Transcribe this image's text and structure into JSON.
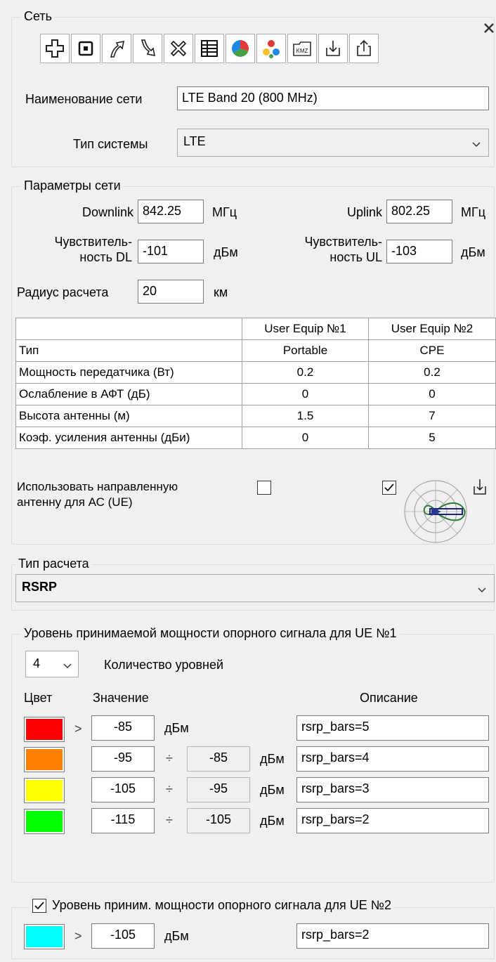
{
  "network_group": {
    "title": "Сеть",
    "toolbar": [
      {
        "icon": "plus-icon"
      },
      {
        "icon": "stop-square-icon"
      },
      {
        "icon": "arrow-up-right-icon"
      },
      {
        "icon": "arrow-down-right-icon"
      },
      {
        "icon": "delete-x-icon"
      },
      {
        "icon": "table-grid-icon"
      },
      {
        "icon": "pie-chart-icon",
        "colors": [
          "#e53935",
          "#43a047",
          "#1e88e5"
        ]
      },
      {
        "icon": "color-dots-icon",
        "colors": [
          "#e53935",
          "#fbc02d",
          "#1e88e5",
          "#43a047"
        ]
      },
      {
        "icon": "kmz-file-icon",
        "label": "KMZ"
      },
      {
        "icon": "download-icon"
      },
      {
        "icon": "share-upload-icon"
      }
    ],
    "close_icon": "close-icon",
    "name_label": "Наименование сети",
    "name_value": "LTE Band 20 (800 MHz)",
    "system_type_label": "Тип системы",
    "system_type_value": "LTE"
  },
  "params": {
    "title": "Параметры сети",
    "downlink_label": "Downlink",
    "downlink_value": "842.25",
    "downlink_unit": "МГц",
    "uplink_label": "Uplink",
    "uplink_value": "802.25",
    "uplink_unit": "МГц",
    "sens_dl_label_1": "Чувствитель-",
    "sens_dl_label_2": "ность DL",
    "sens_dl_value": "-101",
    "sens_dl_unit": "дБм",
    "sens_ul_label_1": "Чувствитель-",
    "sens_ul_label_2": "ность UL",
    "sens_ul_value": "-103",
    "sens_ul_unit": "дБм",
    "radius_label": "Радиус расчета",
    "radius_value": "20",
    "radius_unit": "км",
    "table": {
      "headers": [
        "",
        "User Equip №1",
        "User Equip №2"
      ],
      "rows": [
        [
          "Тип",
          "Portable",
          "CPE"
        ],
        [
          "Мощность передатчика (Вт)",
          "0.2",
          "0.2"
        ],
        [
          "Ослабление в АФТ (дБ)",
          "0",
          "0"
        ],
        [
          "Высота антенны (м)",
          "1.5",
          "7"
        ],
        [
          "Коэф. усиления антенны (дБи)",
          "0",
          "5"
        ]
      ]
    },
    "directional_label_1": "Использовать направленную",
    "directional_label_2": "антенну для АС (UE)",
    "directional_ue1_checked": false,
    "directional_ue2_checked": true
  },
  "calc_type": {
    "title": "Тип расчета",
    "value": "RSRP"
  },
  "levels_ue1": {
    "title": "Уровень принимаемой мощности опорного сигнала для UE №1",
    "count_value": "4",
    "count_label": "Количество уровней",
    "col_color": "Цвет",
    "col_value": "Значение",
    "col_description": "Описание",
    "rows": [
      {
        "color": "#ff0000",
        "op": ">",
        "from": "-85",
        "to": "",
        "unit": "дБм",
        "description": "rsrp_bars=5"
      },
      {
        "color": "#ff8000",
        "op": "",
        "from": "-95",
        "sep": "÷",
        "to": "-85",
        "unit": "дБм",
        "description": "rsrp_bars=4"
      },
      {
        "color": "#ffff00",
        "op": "",
        "from": "-105",
        "sep": "÷",
        "to": "-95",
        "unit": "дБм",
        "description": "rsrp_bars=3"
      },
      {
        "color": "#00ff00",
        "op": "",
        "from": "-115",
        "sep": "÷",
        "to": "-105",
        "unit": "дБм",
        "description": "rsrp_bars=2"
      }
    ]
  },
  "levels_ue2": {
    "enabled": true,
    "title": "Уровень приним. мощности опорного сигнала для UE №2",
    "row": {
      "color": "#00ffff",
      "op": ">",
      "from": "-105",
      "unit": "дБм",
      "description": "rsrp_bars=2"
    }
  }
}
